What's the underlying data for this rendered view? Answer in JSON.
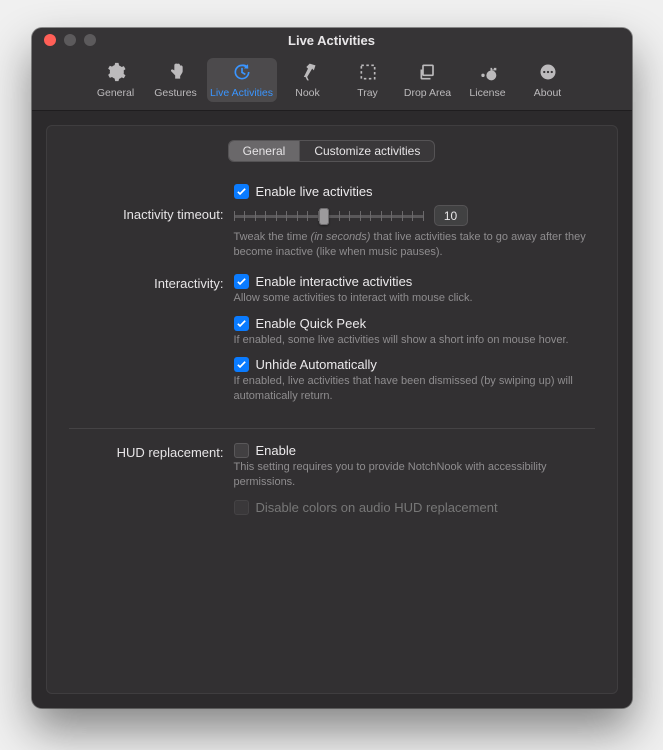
{
  "window_title": "Live Activities",
  "toolbar": [
    {
      "label": "General"
    },
    {
      "label": "Gestures"
    },
    {
      "label": "Live Activities"
    },
    {
      "label": "Nook"
    },
    {
      "label": "Tray"
    },
    {
      "label": "Drop Area"
    },
    {
      "label": "License"
    },
    {
      "label": "About"
    }
  ],
  "tabs": {
    "a": "General",
    "b": "Customize activities"
  },
  "section1": {
    "enable_label": "Enable live activities",
    "timeout_label": "Inactivity timeout:",
    "timeout_value": "10",
    "timeout_help_pre": "Tweak the time ",
    "timeout_help_em": "(in seconds)",
    "timeout_help_post": " that live activities take to go away after they become inactive (like when music pauses)."
  },
  "section2": {
    "label": "Interactivity:",
    "interactive_label": "Enable interactive activities",
    "interactive_help": "Allow some activities to interact with mouse click.",
    "quickpeek_label": "Enable Quick Peek",
    "quickpeek_help": "If enabled, some live activities will show a short info on mouse hover.",
    "unhide_label": "Unhide Automatically",
    "unhide_help": "If enabled, live activities that have been dismissed (by swiping up) will automatically return."
  },
  "section3": {
    "label": "HUD replacement:",
    "enable_label": "Enable",
    "enable_help": "This setting requires you to provide NotchNook with accessibility permissions.",
    "disable_colors_label": "Disable colors on audio HUD replacement"
  }
}
